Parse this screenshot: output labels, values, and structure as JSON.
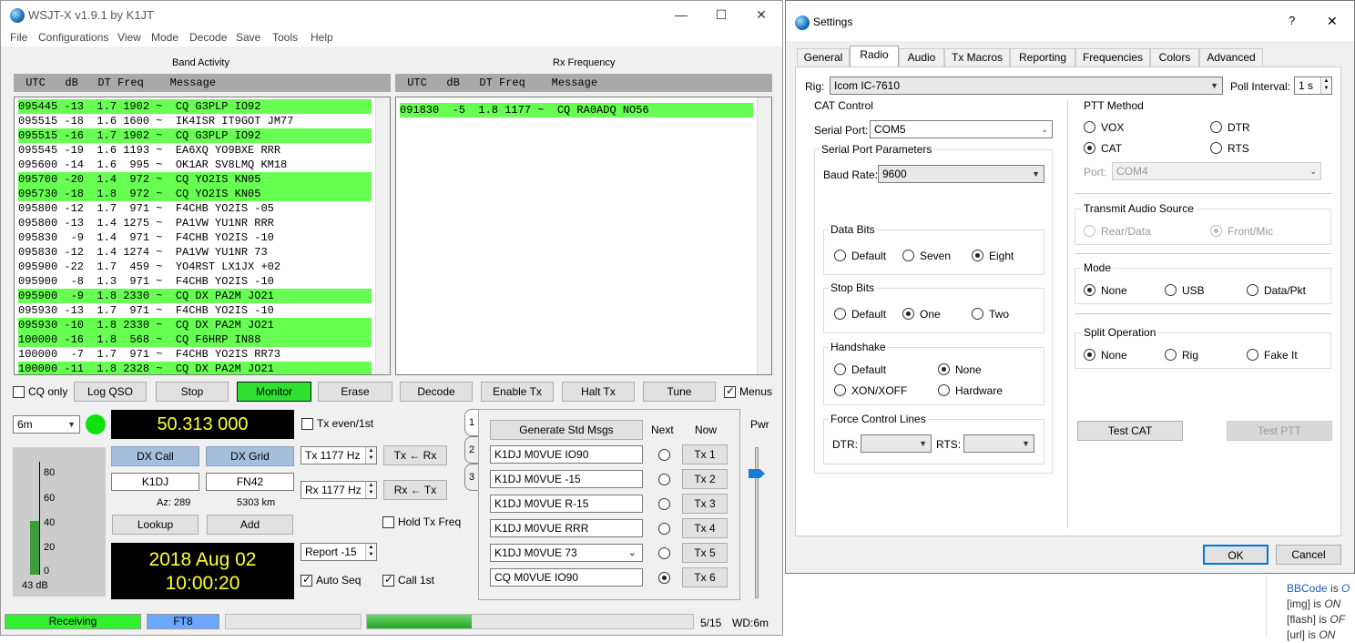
{
  "wsjt": {
    "title": "WSJT-X  v1.9.1   by K1JT",
    "menu": [
      "File",
      "Configurations",
      "View",
      "Mode",
      "Decode",
      "Save",
      "Tools",
      "Help"
    ],
    "band_activity_label": "Band Activity",
    "rx_frequency_label": "Rx Frequency",
    "col_header": " UTC   dB   DT Freq    Message",
    "band_rows": [
      {
        "text": "095445 -13  1.7 1902 ~  CQ G3PLP IO92",
        "cq": true
      },
      {
        "text": "095515 -18  1.6 1600 ~  IK4ISR IT9GOT JM77",
        "cq": false
      },
      {
        "text": "095515 -16  1.7 1902 ~  CQ G3PLP IO92",
        "cq": true
      },
      {
        "text": "095545 -19  1.6 1193 ~  EA6XQ YO9BXE RRR",
        "cq": false
      },
      {
        "text": "095600 -14  1.6  995 ~  OK1AR SV8LMQ KM18",
        "cq": false
      },
      {
        "text": "095700 -20  1.4  972 ~  CQ YO2IS KN05",
        "cq": true
      },
      {
        "text": "095730 -18  1.8  972 ~  CQ YO2IS KN05",
        "cq": true
      },
      {
        "text": "095800 -12  1.7  971 ~  F4CHB YO2IS -05",
        "cq": false
      },
      {
        "text": "095800 -13  1.4 1275 ~  PA1VW YU1NR RRR",
        "cq": false
      },
      {
        "text": "095830  -9  1.4  971 ~  F4CHB YO2IS -10",
        "cq": false
      },
      {
        "text": "095830 -12  1.4 1274 ~  PA1VW YU1NR 73",
        "cq": false
      },
      {
        "text": "095900 -22  1.7  459 ~  YO4RST LX1JX +02",
        "cq": false
      },
      {
        "text": "095900  -8  1.3  971 ~  F4CHB YO2IS -10",
        "cq": false
      },
      {
        "text": "095900  -9  1.8 2330 ~  CQ DX PA2M JO21",
        "cq": true
      },
      {
        "text": "095930 -13  1.7  971 ~  F4CHB YO2IS -10",
        "cq": false
      },
      {
        "text": "095930 -10  1.8 2330 ~  CQ DX PA2M JO21",
        "cq": true
      },
      {
        "text": "100000 -16  1.8  568 ~  CQ F6HRP IN88",
        "cq": true
      },
      {
        "text": "100000  -7  1.7  971 ~  F4CHB YO2IS RR73",
        "cq": false
      },
      {
        "text": "100000 -11  1.8 2328 ~  CQ DX PA2M JO21",
        "cq": true
      }
    ],
    "rx_rows": [
      {
        "text": "091830  -5  1.8 1177 ~  CQ RA0ADQ NO56",
        "cq": true
      }
    ],
    "buttons": {
      "cq_only": "CQ only",
      "log_qso": "Log QSO",
      "stop": "Stop",
      "monitor": "Monitor",
      "erase": "Erase",
      "decode": "Decode",
      "enable_tx": "Enable Tx",
      "halt_tx": "Halt Tx",
      "tune": "Tune",
      "menus": "Menus"
    },
    "band": "6m",
    "frequency": "50.313 000",
    "tx_even": "Tx even/1st",
    "dx_call_label": "DX Call",
    "dx_grid_label": "DX Grid",
    "dx_call": "K1DJ",
    "dx_grid": "FN42",
    "az": "Az: 289",
    "dist": "5303 km",
    "lookup": "Lookup",
    "add": "Add",
    "date": "2018 Aug 02",
    "time": "10:00:20",
    "meter_labels": [
      "80",
      "60",
      "40",
      "20",
      "0"
    ],
    "meter_level_db": 43,
    "meter_db": "43 dB",
    "tx_freq": "Tx  1177  Hz",
    "rx_freq": "Rx  1177  Hz",
    "tx_from_rx": "Tx ← Rx",
    "rx_from_tx": "Rx ← Tx",
    "hold_tx_freq": "Hold Tx Freq",
    "report": "Report -15",
    "auto_seq": "Auto Seq",
    "call_1st": "Call 1st",
    "tab_numbers": [
      "1",
      "2",
      "3"
    ],
    "gen_std": "Generate Std Msgs",
    "next": "Next",
    "now": "Now",
    "pwr": "Pwr",
    "messages": [
      "K1DJ M0VUE IO90",
      "K1DJ M0VUE -15",
      "K1DJ M0VUE R-15",
      "K1DJ M0VUE RRR",
      "K1DJ M0VUE 73",
      "CQ M0VUE IO90"
    ],
    "tx_buttons": [
      "Tx 1",
      "Tx 2",
      "Tx 3",
      "Tx 4",
      "Tx 5",
      "Tx 6"
    ],
    "status": {
      "receiving": "Receiving",
      "mode": "FT8",
      "seq": "5/15",
      "wd": "WD:6m"
    },
    "progress_fraction": 0.32
  },
  "settings": {
    "title": "Settings",
    "help": "?",
    "close": "✕",
    "tabs": [
      "General",
      "Radio",
      "Audio",
      "Tx Macros",
      "Reporting",
      "Frequencies",
      "Colors",
      "Advanced"
    ],
    "rig_label": "Rig:",
    "rig": "Icom IC-7610",
    "poll_label": "Poll Interval:",
    "poll": "1 s",
    "cat_control": "CAT Control",
    "serial_port_label": "Serial Port:",
    "serial_port": "COM5",
    "serial_params": "Serial Port Parameters",
    "baud_label": "Baud Rate:",
    "baud": "9600",
    "data_bits": "Data Bits",
    "data_bits_opts": [
      "Default",
      "Seven",
      "Eight"
    ],
    "stop_bits": "Stop Bits",
    "stop_bits_opts": [
      "Default",
      "One",
      "Two"
    ],
    "handshake": "Handshake",
    "handshake_opts": [
      "Default",
      "None",
      "XON/XOFF",
      "Hardware"
    ],
    "force_lines": "Force Control Lines",
    "dtr": "DTR:",
    "rts": "RTS:",
    "ptt_method": "PTT Method",
    "ptt_opts": [
      "VOX",
      "DTR",
      "CAT",
      "RTS"
    ],
    "port_label": "Port:",
    "port": "COM4",
    "tx_audio": "Transmit Audio Source",
    "tx_audio_opts": [
      "Rear/Data",
      "Front/Mic"
    ],
    "mode": "Mode",
    "mode_opts": [
      "None",
      "USB",
      "Data/Pkt"
    ],
    "split": "Split Operation",
    "split_opts": [
      "None",
      "Rig",
      "Fake It"
    ],
    "test_cat": "Test CAT",
    "test_ptt": "Test PTT",
    "ok": "OK",
    "cancel": "Cancel"
  },
  "background_text": {
    "bbcode": "BBCode",
    "bbcode_is": " is ",
    "img": "[img] is ",
    "flash": "[flash] is ",
    "url": "[url] is ",
    "on": "ON",
    "off": "OF",
    "letter_o": "O"
  }
}
